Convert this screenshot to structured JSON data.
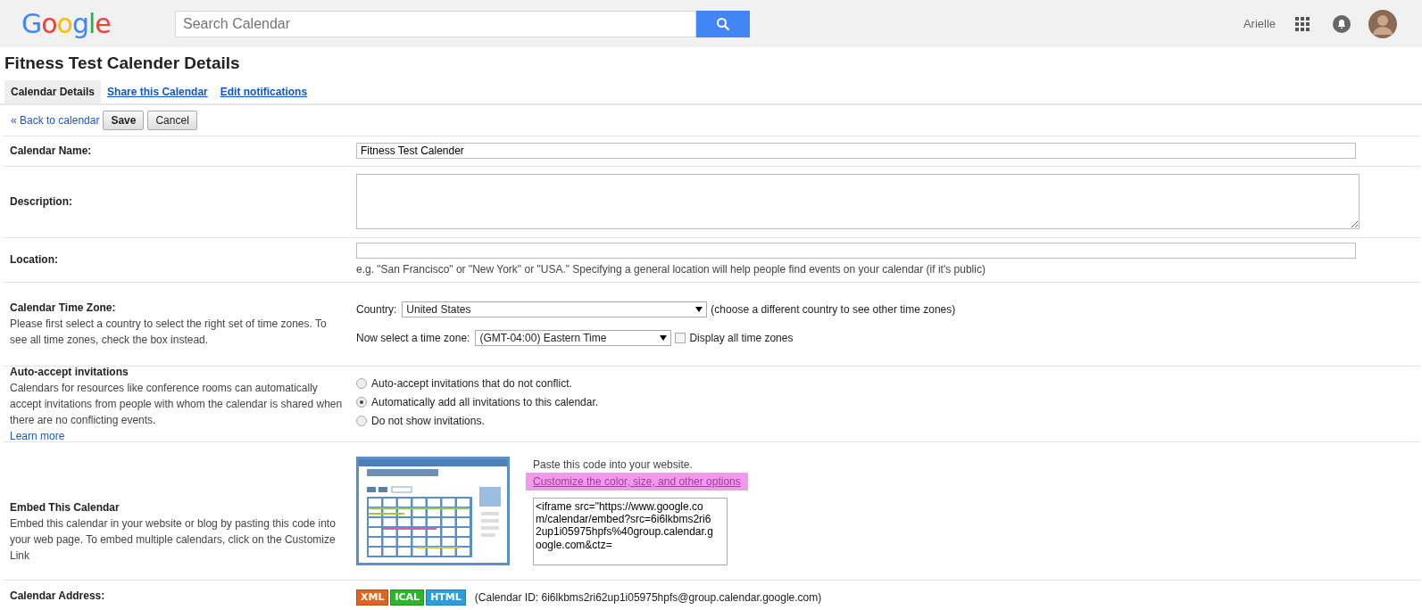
{
  "header": {
    "logo": "Google",
    "search": {
      "placeholder": "Search Calendar"
    },
    "user_name": "Arielle"
  },
  "page_title": "Fitness Test Calender Details",
  "tabs": [
    {
      "label": "Calendar Details",
      "selected": true
    },
    {
      "label": "Share this Calendar",
      "selected": false
    },
    {
      "label": "Edit notifications",
      "selected": false
    }
  ],
  "toolbar": {
    "back_link": "« Back to calendar",
    "buttons": [
      "Save",
      "Cancel"
    ]
  },
  "sections": [
    {
      "kind": "text",
      "label": "Calendar Name:",
      "value": "Fitness Test Calender"
    },
    {
      "kind": "textarea",
      "label": "Description:"
    },
    {
      "kind": "location",
      "label": "Location:",
      "hint": "e.g. \"San Francisco\" or \"New York\" or \"USA.\" Specifying a general location will help people find events on your calendar (if it's public)"
    },
    {
      "kind": "timezone",
      "label": "Calendar Time Zone:",
      "description": "Please first select a country to select the right set of time zones. To see all time zones, check the box instead.",
      "country_label": "Country:",
      "country": "United States",
      "country_note": "(choose a different country to see other time zones)",
      "zone_label": "Now select a time zone:",
      "zone": "(GMT-04:00) Eastern Time",
      "show_all": {
        "label": "Display all time zones",
        "checked": false
      }
    },
    {
      "kind": "radios",
      "label": "Auto-accept invitations",
      "description": "Calendars for resources like conference rooms can automatically accept invitations from people with whom the calendar is shared when there are no conflicting events.",
      "link": "Learn more",
      "options": [
        {
          "label": "Auto-accept invitations that do not conflict.",
          "selected": false
        },
        {
          "label": "Automatically add all invitations to this calendar.",
          "selected": true
        },
        {
          "label": "Do not show invitations.",
          "selected": false
        }
      ]
    },
    {
      "kind": "embed",
      "label": "Embed This Calendar",
      "description": "Embed this calendar in your website or blog by pasting this code into your web page. To embed multiple calendars, click on the Customize Link",
      "instruction": "Paste this code into your website.",
      "link": {
        "label": "Customize the color, size, and other options",
        "highlighted": true
      },
      "code": "<iframe src=\"https://www.google.com/calendar/embed?src=6i6lkbms2ri62up1i05975hpfs%40group.calendar.google.com&ctz="
    },
    {
      "kind": "address",
      "label": "Calendar Address:",
      "badges": [
        {
          "label": "XML",
          "color": "#e0641e"
        },
        {
          "label": "ICAL",
          "color": "#2db52d"
        },
        {
          "label": "HTML",
          "color": "#2a9fe0"
        }
      ],
      "calendar_id": "(Calendar ID: 6i6lkbms2ri62up1i05975hpfs@group.calendar.google.com)"
    }
  ]
}
